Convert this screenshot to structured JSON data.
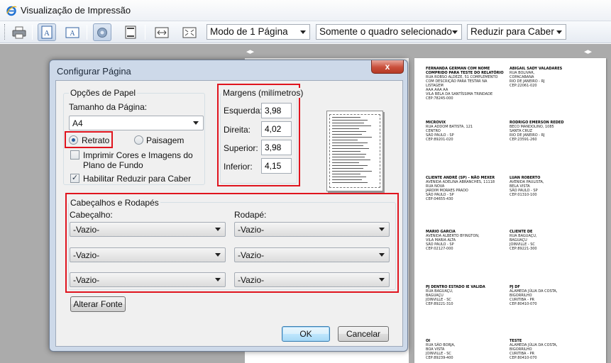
{
  "window": {
    "title": "Visualização de Impressão"
  },
  "toolbar": {
    "print_icon": "printer-icon",
    "portrait_icon": "portrait-page-icon",
    "landscape_icon": "landscape-page-icon",
    "settings_icon": "gear-icon",
    "header_footer_icon": "header-footer-icon",
    "width_icon": "page-width-icon",
    "fullpage_icon": "full-page-icon",
    "view_mode": "Modo de 1 Página",
    "print_scope": "Somente o quadro selecionado",
    "fit": "Reduzir para Caber"
  },
  "dialog": {
    "title": "Configurar Página",
    "close_label": "x",
    "paper_options": {
      "legend": "Opções de Papel",
      "page_size_label": "Tamanho da Página:",
      "page_size": "A4",
      "portrait_label": "Retrato",
      "landscape_label": "Paisagem",
      "portrait_selected": true,
      "print_colors_label": "Imprimir Cores e Imagens do Plano de Fundo",
      "print_colors_checked": false,
      "shrink_label": "Habilitar Reduzir para Caber",
      "shrink_checked": true
    },
    "margins": {
      "legend": "Margens (milímetros)",
      "left_label": "Esquerda:",
      "left": "3,98",
      "right_label": "Direita:",
      "right": "4,02",
      "top_label": "Superior:",
      "top": "3,98",
      "bottom_label": "Inferior:",
      "bottom": "4,15"
    },
    "headers_footers": {
      "legend": "Cabeçalhos e Rodapés",
      "header_label": "Cabeçalho:",
      "footer_label": "Rodapé:",
      "header": [
        "-Vazio-",
        "-Vazio-",
        "-Vazio-"
      ],
      "footer": [
        "-Vazio-",
        "-Vazio-",
        "-Vazio-"
      ]
    },
    "change_font": "Alterar Fonte",
    "ok": "OK",
    "cancel": "Cancelar"
  },
  "preview_labels": [
    {
      "name": "FERNANDA GERMAN COM NOME\nCOMPRIDO PARA TESTE DO RELATÓRIO",
      "lines": "RUA ROBSO ALDEZE, 51 COMPLEMENTO\nCOM DESCRIÇÃO PARA TESTAR NA\nLISTAGEM\nAAA AAA AA\nVILA BELA DA SANTÍSSIMA TRINDADE\nCEP:78245-000"
    },
    {
      "name": "ABIGAIL SADY VALADARES",
      "lines": "RUA BOLIVAR,\nCOPACABANA\nRIO DE JANEIRO - RJ\nCEP:22061-020"
    },
    {
      "name": "MICROVIX",
      "lines": "RUA ADDOM BATISTA, 121\nCENTRO\nSÃO PAULO - SP\nCEP:89201-020"
    },
    {
      "name": "RODRIGO EMERSON REDED",
      "lines": "BECO MANDOLINO, 1085\nSANTA CRUZ\nRIO DE JANEIRO - RJ\nCEP:23591-260"
    },
    {
      "name": "CLIENTE ANDRÉ (SP) - NÃO MEXER",
      "lines": "AVENIDA ADELINA ABRANCHES, 11118\nRUA NOVA\nJARDIM MORAES PRADO\nSÃO PAULO - SP\nCEP:04655-430"
    },
    {
      "name": "LUAN ROBERTO",
      "lines": "AVENIDA PAULISTA,\nBELA VISTA\nSÃO PAULO - SP\nCEP:01310-100"
    },
    {
      "name": "MARIO GARCIA",
      "lines": "AVENIDA ALBERTO BYINGTON,\nVILA MARIA ALTA\nSÃO PAULO - SP\nCEP:02127-000"
    },
    {
      "name": "CLIENTE DE",
      "lines": "RUA BAGUAÇU,\nBAGUAÇU\nJOINVILLE - SC\nCEP:89221-300"
    },
    {
      "name": "PJ DENTRO ESTADO IE VALIDA",
      "lines": "RUA BAGUAÇU,\nBAGUAÇU\nJOINVILLE - SC\nCEP:89221-310"
    },
    {
      "name": "PJ DF",
      "lines": "ALAMEDA JÚLIA DA COSTA,\nBIGORRILHO\nCURITIBA - PR\nCEP:80410-070"
    },
    {
      "name": "OI",
      "lines": "RUA SÃO BORJA,\nBOA VISTA\nJOINVILLE - SC\nCEP:89239-400"
    },
    {
      "name": "TESTE",
      "lines": "ALAMEDA JÚLIA DA COSTA,\nBIGORRILHO\nCURITIBA - PR\nCEP:80410-070"
    }
  ]
}
